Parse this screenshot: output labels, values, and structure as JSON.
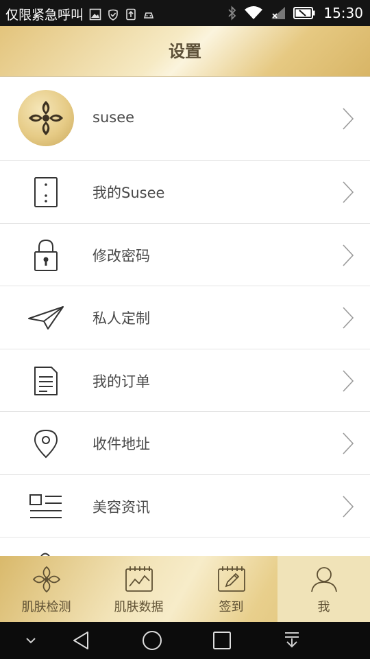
{
  "status_bar": {
    "carrier_text": "仅限紧急呼叫",
    "time": "15:30"
  },
  "header": {
    "title": "设置"
  },
  "profile": {
    "username": "susee"
  },
  "menu_items": [
    {
      "label": "我的Susee",
      "icon": "phone-icon"
    },
    {
      "label": "修改密码",
      "icon": "lock-icon"
    },
    {
      "label": "私人定制",
      "icon": "paper-plane-icon"
    },
    {
      "label": "我的订单",
      "icon": "document-icon"
    },
    {
      "label": "收件地址",
      "icon": "location-pin-icon"
    },
    {
      "label": "美容资讯",
      "icon": "news-icon"
    }
  ],
  "tabs": [
    {
      "label": "肌肤检测",
      "icon": "flower-icon",
      "active": false
    },
    {
      "label": "肌肤数据",
      "icon": "chart-calendar-icon",
      "active": false
    },
    {
      "label": "签到",
      "icon": "sign-in-icon",
      "active": false
    },
    {
      "label": "我",
      "icon": "user-icon",
      "active": true
    }
  ],
  "colors": {
    "gold_accent": "#e3c47c",
    "header_text": "#5d5139",
    "status_bar_bg": "#141414",
    "nav_bar_bg": "#0c0c0c"
  }
}
